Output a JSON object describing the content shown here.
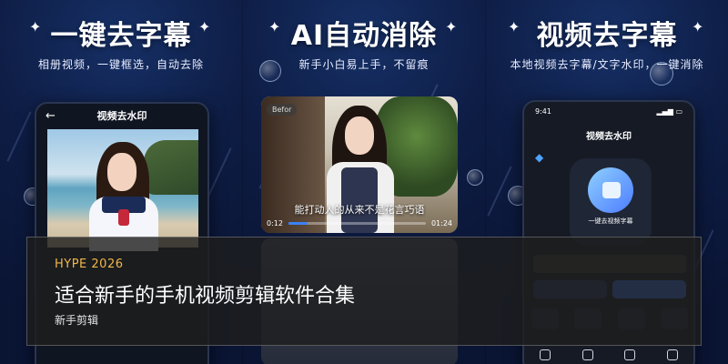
{
  "panels": [
    {
      "headline": "一键去字幕",
      "subline": "相册视频，一键框选，自动去除",
      "screen_title": "视频去水印"
    },
    {
      "headline": "AI自动消除",
      "subline": "新手小白易上手，不留痕",
      "before_label": "Befor",
      "subtitle_text": "能打动人的从来不是花言巧语",
      "time_start": "0:12",
      "time_end": "01:24",
      "progress_fraction": 0.14
    },
    {
      "headline": "视频去字幕",
      "subline": "本地视频去字幕/文字水印，一键消除",
      "status_time": "9:41",
      "screen_title": "视频去水印",
      "card_label": "一键去视频字幕"
    }
  ],
  "overlay": {
    "tag": "HYPE 2026",
    "title": "适合新手的手机视频剪辑软件合集",
    "subtitle": "新手剪辑"
  },
  "colors": {
    "accent": "#f0b84a",
    "progress": "#3b82f6",
    "background": "#0b1430"
  }
}
